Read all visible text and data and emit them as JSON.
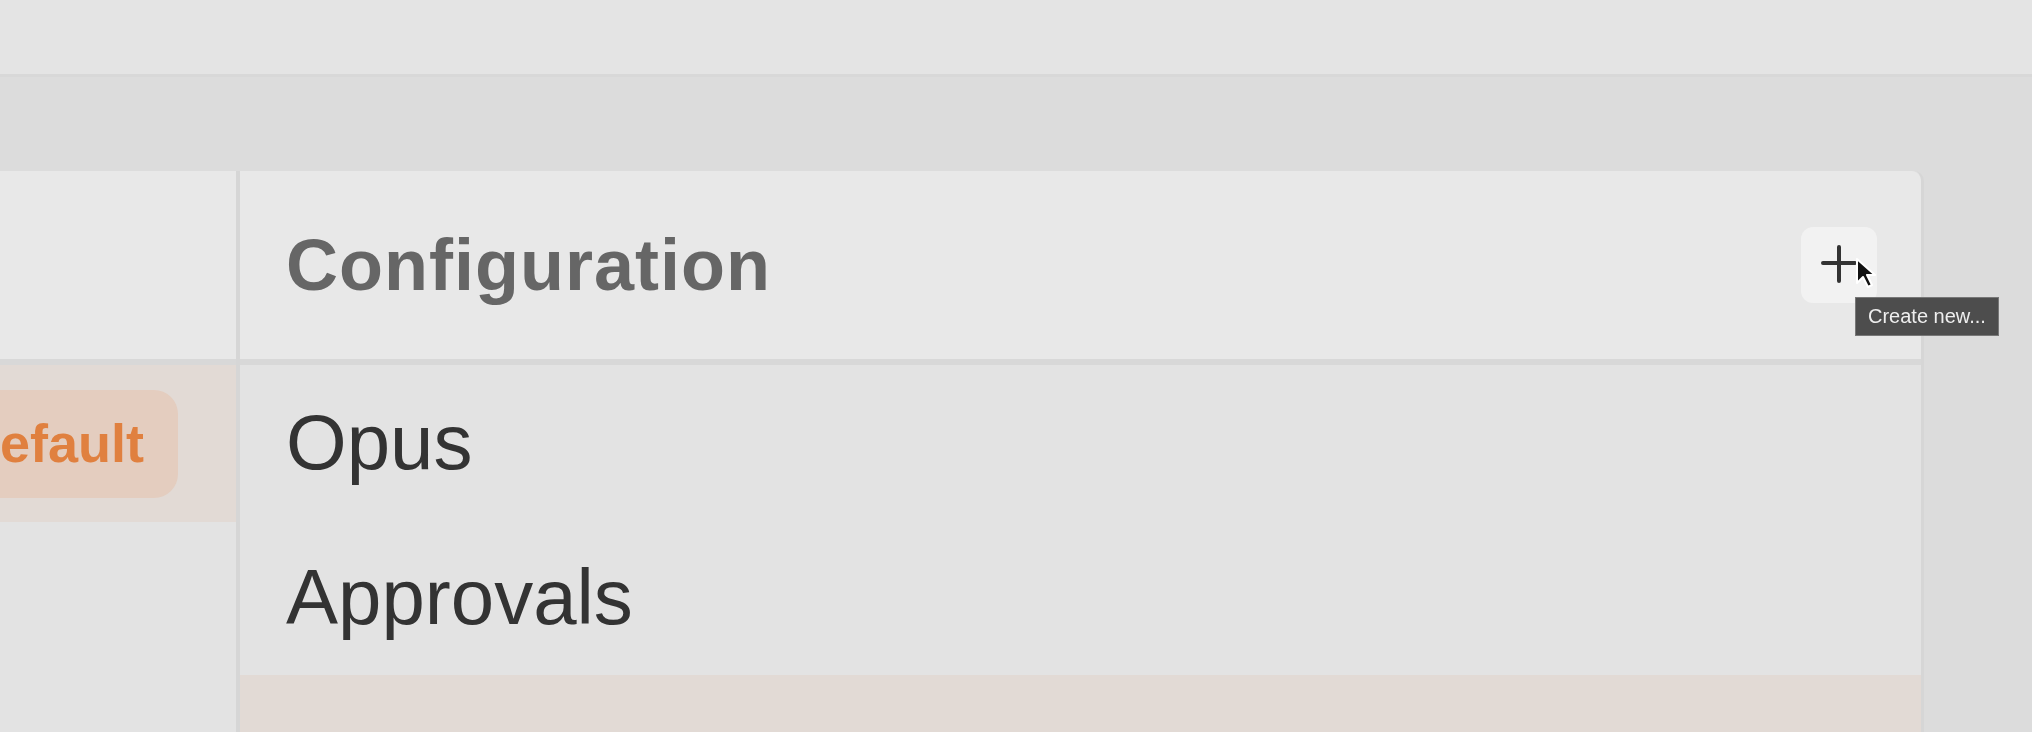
{
  "left_panel": {
    "rows": [
      {
        "badge": "efault",
        "selected": true
      }
    ]
  },
  "configuration": {
    "title": "Configuration",
    "add_button": {
      "tooltip": "Create new..."
    },
    "items": [
      {
        "label": "Opus",
        "selected": false
      },
      {
        "label": "Approvals",
        "selected": false
      },
      {
        "selected": true
      }
    ]
  }
}
